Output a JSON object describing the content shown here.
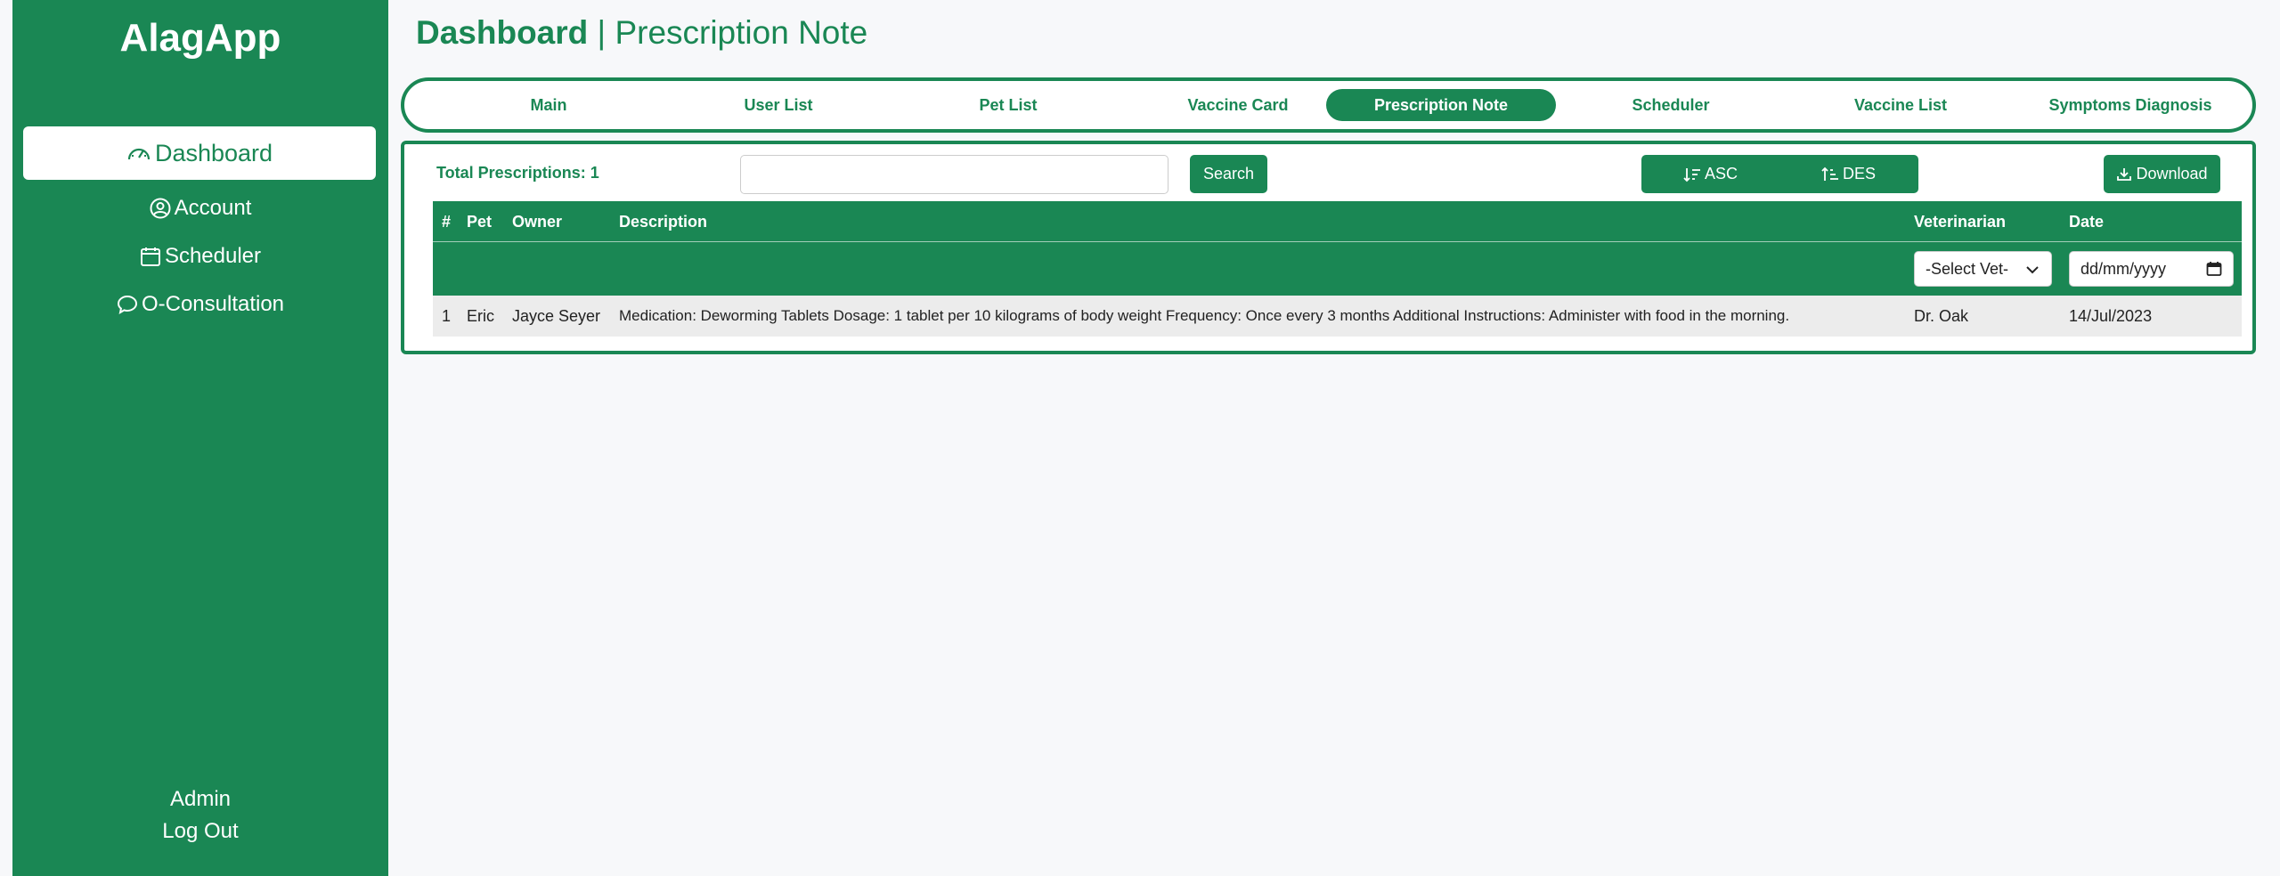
{
  "sidebar": {
    "brand": "AlagApp",
    "items": [
      {
        "label": "Dashboard",
        "icon": "speedometer-icon"
      },
      {
        "label": "Account",
        "icon": "user-circle-icon"
      },
      {
        "label": "Scheduler",
        "icon": "calendar-icon"
      },
      {
        "label": "O-Consultation",
        "icon": "chat-bubble-icon"
      }
    ],
    "footer": {
      "admin": "Admin",
      "logout": "Log Out"
    }
  },
  "header": {
    "title_bold": "Dashboard",
    "separator": " | ",
    "title_rest": "Prescription Note"
  },
  "tabs": [
    {
      "label": "Main"
    },
    {
      "label": "User List"
    },
    {
      "label": "Pet List"
    },
    {
      "label": "Vaccine Card"
    },
    {
      "label": "Prescription Note",
      "active": true
    },
    {
      "label": "Scheduler"
    },
    {
      "label": "Vaccine List"
    },
    {
      "label": "Symptoms Diagnosis"
    }
  ],
  "toolbar": {
    "total_label": "Total Prescriptions: 1",
    "search_value": "",
    "search_button": "Search",
    "asc_label": "ASC",
    "des_label": "DES",
    "download_label": "Download"
  },
  "table": {
    "headers": [
      "#",
      "Pet",
      "Owner",
      "Description",
      "Veterinarian",
      "Date"
    ],
    "filters": {
      "vet_select": "-Select Vet-",
      "date_placeholder": "dd/mm/yyyy"
    },
    "rows": [
      {
        "num": "1",
        "pet": "Eric",
        "owner": "Jayce Seyer",
        "description": "Medication: Deworming Tablets Dosage: 1 tablet per 10 kilograms of body weight Frequency: Once every 3 months Additional Instructions: Administer with food in the morning.",
        "vet": "Dr. Oak",
        "date": "14/Jul/2023"
      }
    ]
  },
  "colors": {
    "accent": "#1a8754",
    "background": "#f7f8fa",
    "row": "#ececec"
  }
}
